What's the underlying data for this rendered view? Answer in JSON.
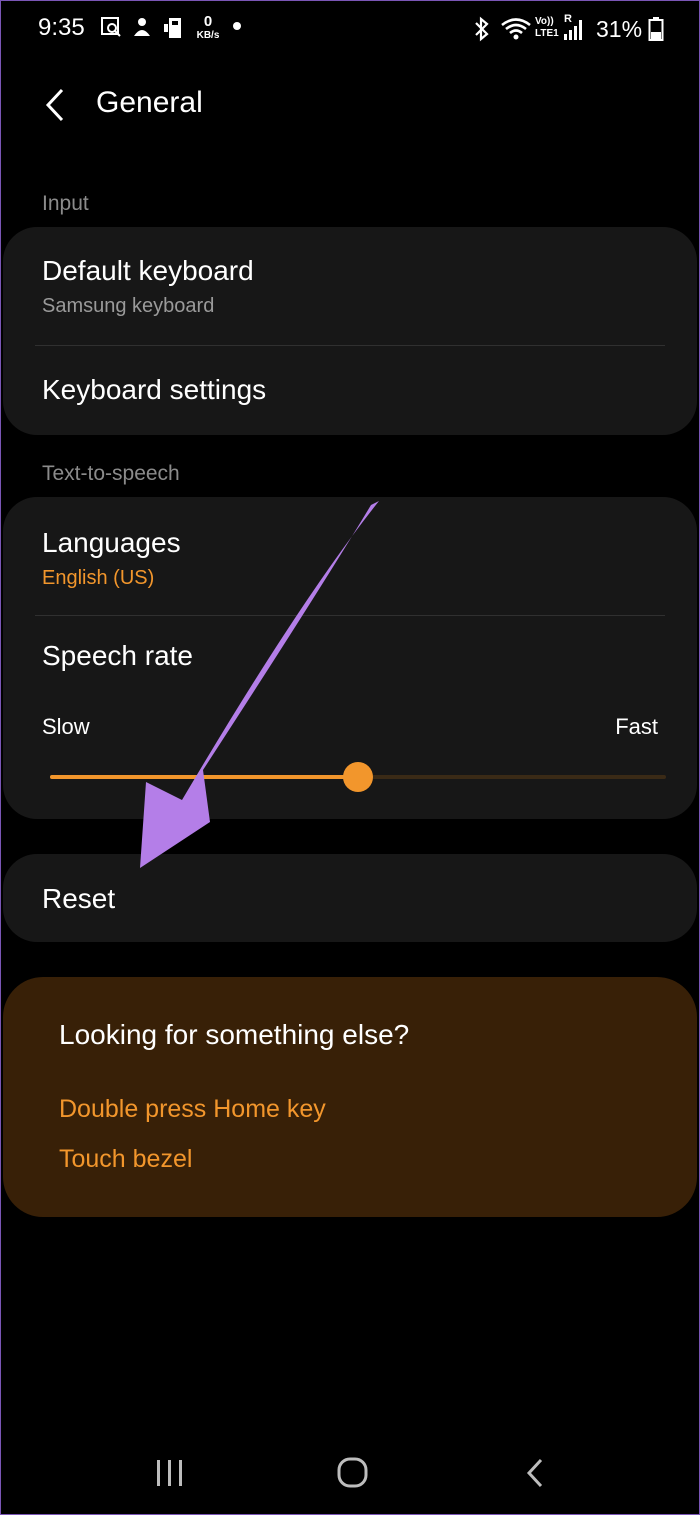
{
  "status_bar": {
    "time": "9:35",
    "kbs_value": "0",
    "kbs_unit": "KB/s",
    "volte_label": "Vo)) LTE1",
    "roaming": "R",
    "battery_percent": "31%"
  },
  "app_bar": {
    "title": "General"
  },
  "input_section": {
    "label": "Input",
    "default_keyboard": {
      "title": "Default keyboard",
      "value": "Samsung keyboard"
    },
    "keyboard_settings": {
      "title": "Keyboard settings"
    }
  },
  "tts_section": {
    "label": "Text-to-speech",
    "languages": {
      "title": "Languages",
      "value": "English (US)"
    },
    "speech_rate": {
      "title": "Speech rate",
      "min_label": "Slow",
      "max_label": "Fast",
      "value": 0.5
    }
  },
  "reset": {
    "title": "Reset"
  },
  "suggestions": {
    "title": "Looking for something else?",
    "links": [
      "Double press Home key",
      "Touch bezel"
    ]
  },
  "colors": {
    "accent": "#f2962c",
    "card": "#171717",
    "suggestion_card": "#382007",
    "annotation_arrow": "#b47ee8"
  },
  "icons": {
    "back": "chevron-left-icon",
    "nav_recents": "recents-icon",
    "nav_home": "home-icon",
    "nav_back": "back-icon"
  }
}
